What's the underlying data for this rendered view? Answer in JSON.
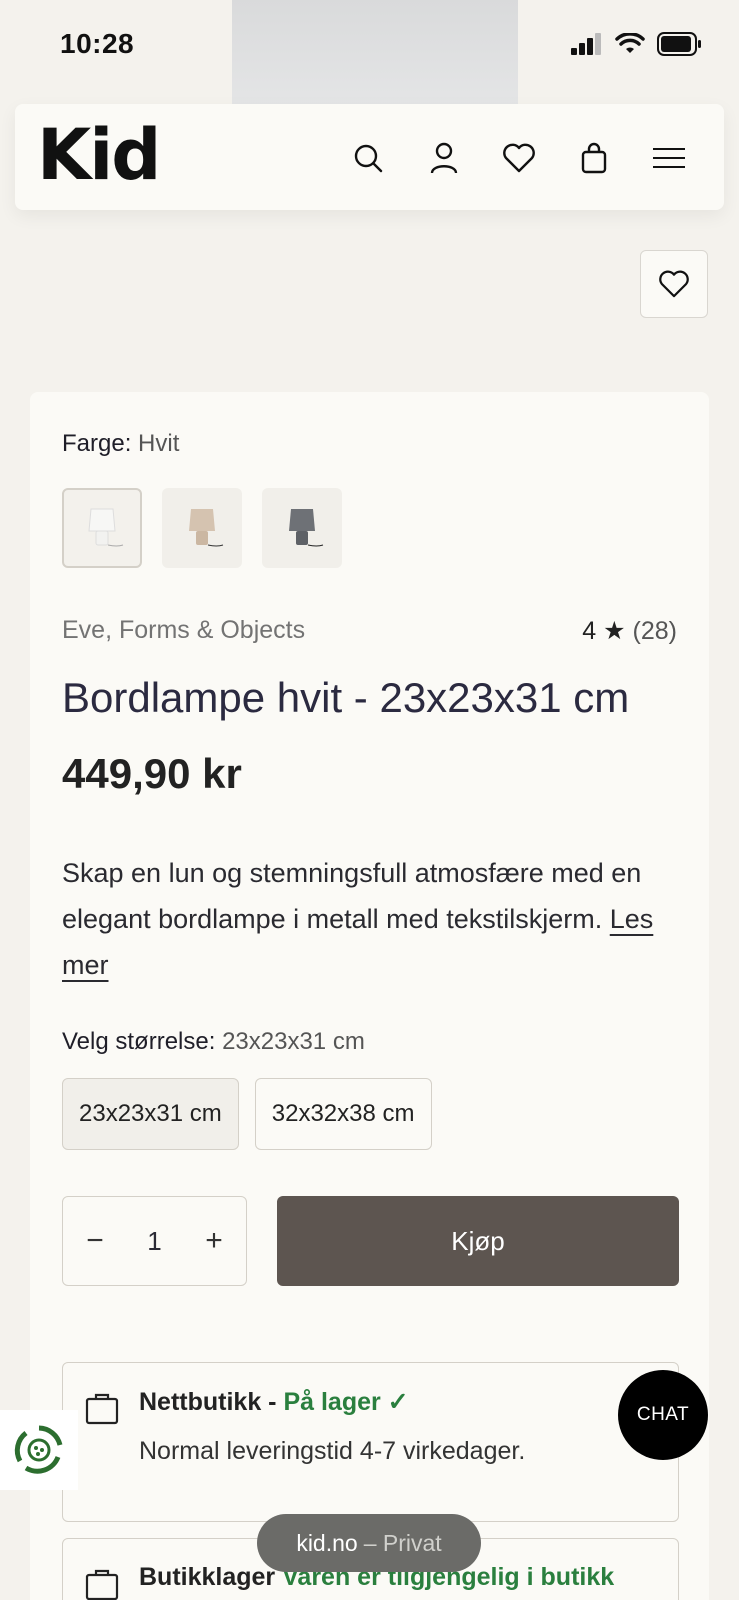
{
  "status": {
    "time": "10:28"
  },
  "header": {
    "logo": "Kid"
  },
  "product": {
    "color_label": "Farge:",
    "color_value": "Hvit",
    "brand": "Eve, Forms & Objects",
    "rating_value": "4",
    "rating_star": "★",
    "rating_count": "(28)",
    "title": "Bordlampe hvit - 23x23x31 cm",
    "price": "449,90 kr",
    "description": "Skap en lun og stemningsfull atmosfære med en elegant bordlampe i metall med tekstilskjerm.",
    "read_more": "Les mer",
    "size_label": "Velg størrelse:",
    "size_value": "23x23x31 cm",
    "sizes": [
      "23x23x31 cm",
      "32x32x38 cm"
    ],
    "quantity": "1",
    "qty_minus": "−",
    "qty_plus": "+",
    "buy_label": "Kjøp"
  },
  "stock": {
    "online_label": "Nettbutikk -",
    "online_status": "På lager ✓",
    "online_sub": "Normal leveringstid 4-7 virkedager.",
    "store_label": "Butikklager",
    "store_status": "Varen er tilgjengelig i butikk"
  },
  "chat": {
    "label": "CHAT"
  },
  "browser": {
    "domain": "kid.no",
    "mode": "– Privat"
  },
  "colors": {
    "accent_buy": "#5d5550",
    "in_stock": "#2a7f3e",
    "background": "#f4f2ed"
  }
}
